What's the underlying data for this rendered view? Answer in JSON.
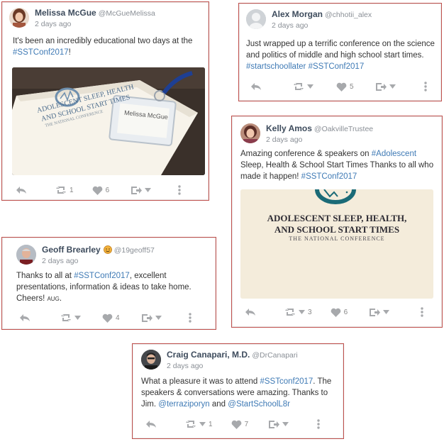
{
  "posts": [
    {
      "name": "Melissa McGue",
      "handle": "@McGueMelissa",
      "time": "2 days ago",
      "text_parts": {
        "a": "It's been an incredibly educational two days at the ",
        "tag1": "#SSTConf2017",
        "b": "!"
      },
      "retweets": "1",
      "likes": "6",
      "photo_text": {
        "line1": "ADOLESCENT SLEEP, HEALTH",
        "line2": "AND SCHOOL START TIMES",
        "line3": "THE NATIONAL CONFERENCE",
        "badge": "Melissa  McGue"
      }
    },
    {
      "name": "Alex Morgan",
      "handle": "@chhotii_alex",
      "time": "2 days ago",
      "text_parts": {
        "a": "Just wrapped up a terrific conference on the science and politics of middle and high school start times. ",
        "tag1": "#startschoollater",
        "tag2": "#SSTConf2017"
      },
      "retweets": "",
      "likes": "5"
    },
    {
      "name": "Kelly Amos",
      "handle": "@OakvilleTrustee",
      "time": "2 days ago",
      "text_parts": {
        "a": "Amazing conference & speakers on ",
        "tag1": "#Adolescent",
        "b": " Sleep, Health & School Start Times Thanks to all who made it happen! ",
        "tag2": "#SSTConf2017"
      },
      "retweets": "3",
      "likes": "6",
      "photo_text": {
        "line1": "ADOLESCENT SLEEP, HEALTH,",
        "line2": "AND SCHOOL START TIMES",
        "line3": "THE NATIONAL CONFERENCE"
      }
    },
    {
      "name": "Geoff Brearley",
      "handle": "@19geoff57",
      "time": "2 days ago",
      "text_parts": {
        "a": "Thanks to all at ",
        "tag1": "#SSTConf2017",
        "b": ", excellent presentations, information & ideas to take home. Cheers! ",
        "small": "AUG",
        "c": "."
      },
      "retweets": "",
      "likes": "4"
    },
    {
      "name": "Craig Canapari, M.D.",
      "handle": "@DrCanapari",
      "time": "2 days ago",
      "text_parts": {
        "a": "What a pleasure it was to attend ",
        "tag1": "#SSTconf2017",
        "b": ". The speakers & conversations were amazing. Thanks to Jim. ",
        "tag2": "@terraziporyn",
        "c": " and ",
        "tag3": "@StartSchoolL8r"
      },
      "retweets": "1",
      "likes": "7"
    }
  ],
  "colors": {
    "border": "#c0504d",
    "link": "#3f7ab5",
    "icon": "#a7a9ac",
    "name": "#3d4b5c"
  },
  "icons": [
    "reply-icon",
    "retweet-icon",
    "heart-icon",
    "share-icon",
    "more-icon",
    "caret-down-icon"
  ]
}
